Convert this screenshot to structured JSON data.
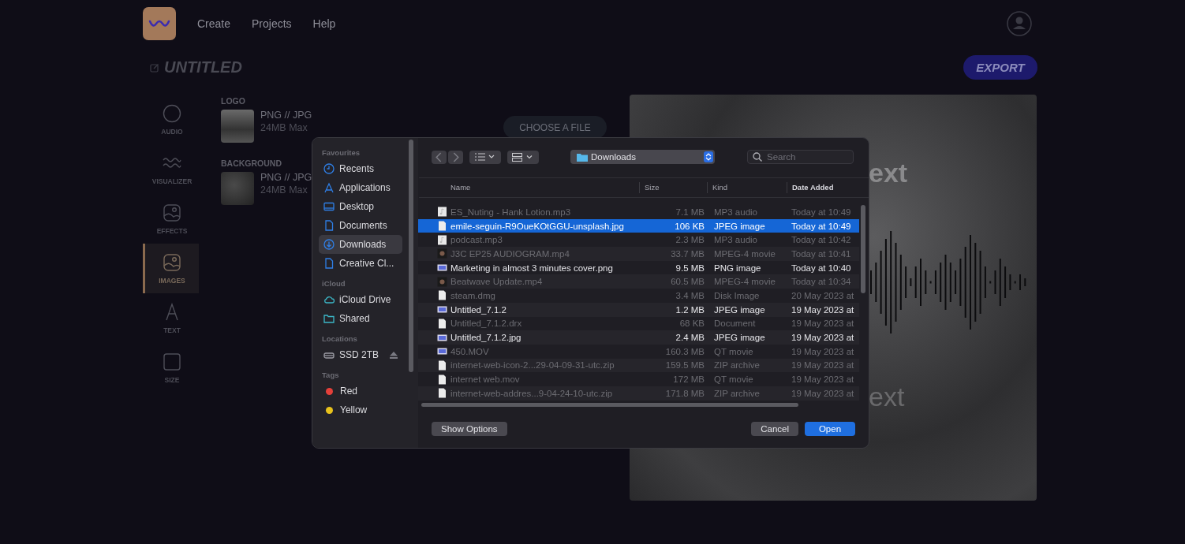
{
  "header": {
    "nav": [
      "Create",
      "Projects",
      "Help"
    ]
  },
  "project": {
    "title": "UNTITLED",
    "export_label": "EXPORT"
  },
  "tools": [
    {
      "label": "AUDIO",
      "kind": "circle",
      "selected": false
    },
    {
      "label": "VISUALIZER",
      "kind": "wave",
      "selected": false
    },
    {
      "label": "EFFECTS",
      "kind": "picture",
      "selected": false
    },
    {
      "label": "IMAGES",
      "kind": "picture",
      "selected": true
    },
    {
      "label": "TEXT",
      "kind": "letter",
      "selected": false
    },
    {
      "label": "SIZE",
      "kind": "square",
      "selected": false
    }
  ],
  "uploads": [
    {
      "title": "LOGO",
      "formats": "PNG // JPG",
      "limit": "24MB Max"
    },
    {
      "title": "BACKGROUND",
      "formats": "PNG // JPG",
      "limit": "24MB Max"
    }
  ],
  "choose_button": "CHOOSE A FILE",
  "preview": {
    "title": "ext",
    "subtitle": "ext"
  },
  "dialog": {
    "sidebar": [
      {
        "heading": "Favourites",
        "items": [
          {
            "label": "Recents",
            "kind": "clock",
            "selected": false
          },
          {
            "label": "Applications",
            "kind": "apps",
            "selected": false
          },
          {
            "label": "Desktop",
            "kind": "desktop",
            "selected": false
          },
          {
            "label": "Documents",
            "kind": "doc",
            "selected": false
          },
          {
            "label": "Downloads",
            "kind": "download",
            "selected": true
          },
          {
            "label": "Creative Cl...",
            "kind": "doc",
            "selected": false
          }
        ]
      },
      {
        "heading": "iCloud",
        "items": [
          {
            "label": "iCloud Drive",
            "kind": "cloud",
            "selected": false
          },
          {
            "label": "Shared",
            "kind": "folder",
            "selected": false
          }
        ]
      },
      {
        "heading": "Locations",
        "items": [
          {
            "label": "SSD 2TB",
            "kind": "drive",
            "selected": false
          }
        ]
      },
      {
        "heading": "Tags",
        "items": [
          {
            "label": "Red",
            "kind": "tag",
            "color": "#e5403a",
            "selected": false
          },
          {
            "label": "Yellow",
            "kind": "tag",
            "color": "#e8c21c",
            "selected": false
          }
        ]
      }
    ],
    "location": "Downloads",
    "search_placeholder": "Search",
    "columns": [
      "Name",
      "Size",
      "Kind",
      "Date Added"
    ],
    "rows": [
      {
        "name": "ES_Nuting - Hank Lotion.mp3",
        "size": "7.1 MB",
        "file_type": "MP3 audio",
        "date": "Today at 10:49",
        "kind": "audio",
        "enabled": false,
        "selected": false
      },
      {
        "name": "emile-seguin-R9OueKOtGGU-unsplash.jpg",
        "size": "106 KB",
        "file_type": "JPEG image",
        "date": "Today at 10:49",
        "kind": "doc",
        "enabled": true,
        "selected": true
      },
      {
        "name": "podcast.mp3",
        "size": "2.3 MB",
        "file_type": "MP3 audio",
        "date": "Today at 10:42",
        "kind": "audio",
        "enabled": false,
        "selected": false
      },
      {
        "name": "J3C EP25 AUDIOGRAM.mp4",
        "size": "33.7 MB",
        "file_type": "MPEG-4 movie",
        "date": "Today at 10:41",
        "kind": "video",
        "enabled": false,
        "selected": false
      },
      {
        "name": "Marketing in almost 3 minutes cover.png",
        "size": "9.5 MB",
        "file_type": "PNG image",
        "date": "Today at 10:40",
        "kind": "image",
        "enabled": true,
        "selected": false
      },
      {
        "name": "Beatwave Update.mp4",
        "size": "60.5 MB",
        "file_type": "MPEG-4 movie",
        "date": "Today at 10:34",
        "kind": "video",
        "enabled": false,
        "selected": false
      },
      {
        "name": "steam.dmg",
        "size": "3.4 MB",
        "file_type": "Disk Image",
        "date": "20 May 2023 at",
        "kind": "doc",
        "enabled": false,
        "selected": false
      },
      {
        "name": "Untitled_7.1.2",
        "size": "1.2 MB",
        "file_type": "JPEG image",
        "date": "19 May 2023 at",
        "kind": "image",
        "enabled": true,
        "selected": false
      },
      {
        "name": "Untitled_7.1.2.drx",
        "size": "68 KB",
        "file_type": "Document",
        "date": "19 May 2023 at",
        "kind": "doc",
        "enabled": false,
        "selected": false
      },
      {
        "name": "Untitled_7.1.2.jpg",
        "size": "2.4 MB",
        "file_type": "JPEG image",
        "date": "19 May 2023 at",
        "kind": "image",
        "enabled": true,
        "selected": false
      },
      {
        "name": "450.MOV",
        "size": "160.3 MB",
        "file_type": "QT movie",
        "date": "19 May 2023 at",
        "kind": "image",
        "enabled": false,
        "selected": false
      },
      {
        "name": "internet-web-icon-2...29-04-09-31-utc.zip",
        "size": "159.5 MB",
        "file_type": "ZIP archive",
        "date": "19 May 2023 at",
        "kind": "doc",
        "enabled": false,
        "selected": false
      },
      {
        "name": "internet web.mov",
        "size": "172 MB",
        "file_type": "QT movie",
        "date": "19 May 2023 at",
        "kind": "doc",
        "enabled": false,
        "selected": false
      },
      {
        "name": "internet-web-addres...9-04-24-10-utc.zip",
        "size": "171.8 MB",
        "file_type": "ZIP archive",
        "date": "19 May 2023 at",
        "kind": "doc",
        "enabled": false,
        "selected": false
      }
    ],
    "options_button": "Show Options",
    "cancel_button": "Cancel",
    "open_button": "Open"
  }
}
